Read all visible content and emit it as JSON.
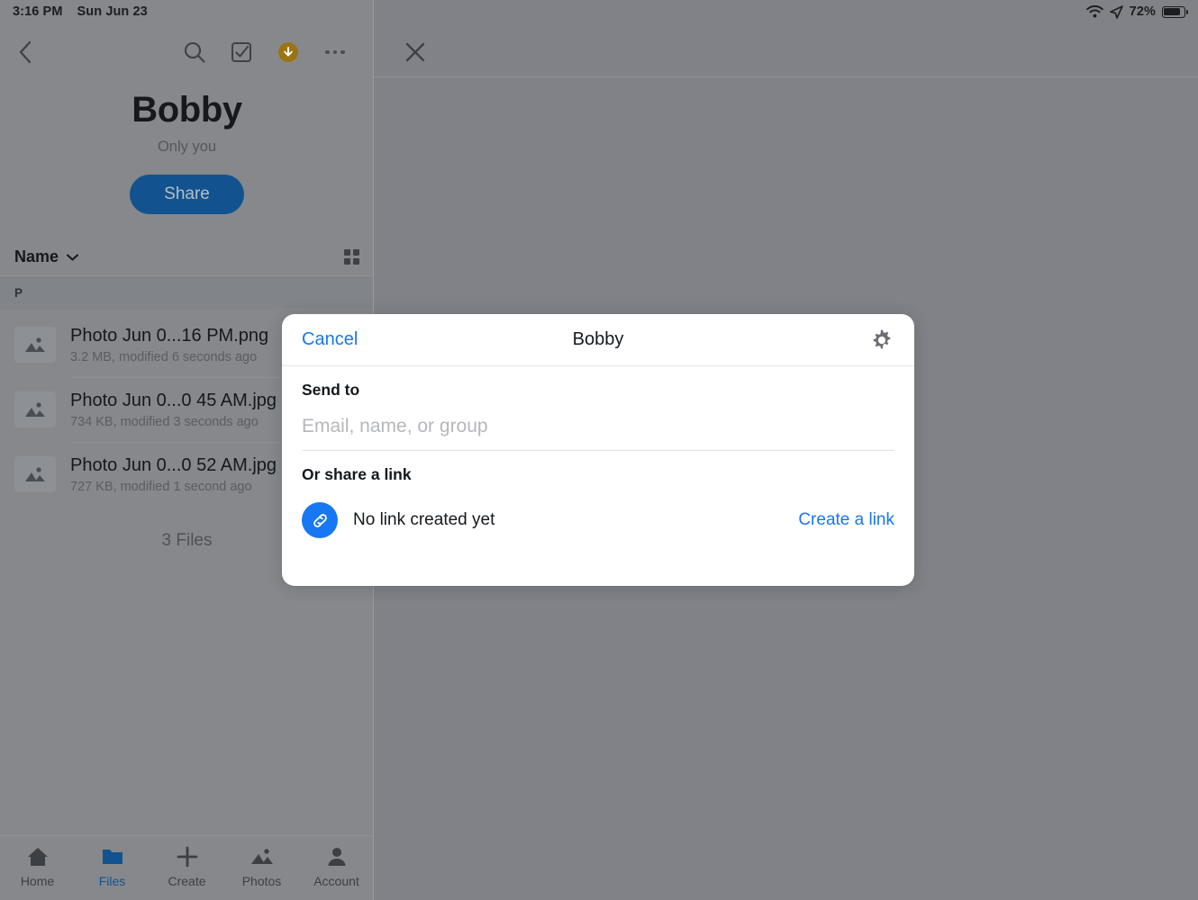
{
  "status_bar": {
    "time": "3:16 PM",
    "date": "Sun Jun 23",
    "battery_percent": "72%",
    "wifi_icon": "wifi-icon",
    "location_icon": "location-arrow-icon",
    "battery_icon": "battery-icon"
  },
  "sidebar": {
    "toolbar": {
      "back_icon": "chevron-left-icon",
      "search_icon": "search-icon",
      "select_icon": "checkbox-select-icon",
      "download_icon": "download-circle-icon",
      "more_icon": "more-horizontal-icon",
      "download_badge_color": "#9b7413"
    },
    "hero": {
      "title": "Bobby",
      "subtitle": "Only you",
      "share_label": "Share",
      "share_color": "#12538f"
    },
    "sort": {
      "label": "Name",
      "chevron_icon": "chevron-down-icon",
      "grid_icon": "grid-view-icon"
    },
    "section_header": "P",
    "files": [
      {
        "name": "Photo Jun 0...16 PM.png",
        "meta": "3.2 MB, modified 6 seconds ago",
        "icon": "image-thumbnail-icon"
      },
      {
        "name": "Photo Jun 0...0 45 AM.jpg",
        "meta": "734 KB, modified 3 seconds ago",
        "icon": "image-thumbnail-icon"
      },
      {
        "name": "Photo Jun 0...0 52 AM.jpg",
        "meta": "727 KB, modified 1 second ago",
        "icon": "image-thumbnail-icon"
      }
    ],
    "file_count": "3 Files",
    "tabs": [
      {
        "label": "Home",
        "icon": "home-icon",
        "active": false
      },
      {
        "label": "Files",
        "icon": "folder-icon",
        "active": true
      },
      {
        "label": "Create",
        "icon": "plus-icon",
        "active": false
      },
      {
        "label": "Photos",
        "icon": "photos-icon",
        "active": false
      },
      {
        "label": "Account",
        "icon": "person-icon",
        "active": false
      }
    ],
    "active_tab_color": "#12538f"
  },
  "right_pane": {
    "close_icon": "close-x-icon"
  },
  "modal": {
    "cancel_label": "Cancel",
    "title": "Bobby",
    "settings_icon": "gear-icon",
    "send_to_label": "Send to",
    "recipient_placeholder": "Email, name, or group",
    "recipient_value": "",
    "share_link_label": "Or share a link",
    "link_icon": "link-chain-icon",
    "link_status": "No link created yet",
    "create_link_label": "Create a link",
    "accent_color": "#1877f2"
  }
}
